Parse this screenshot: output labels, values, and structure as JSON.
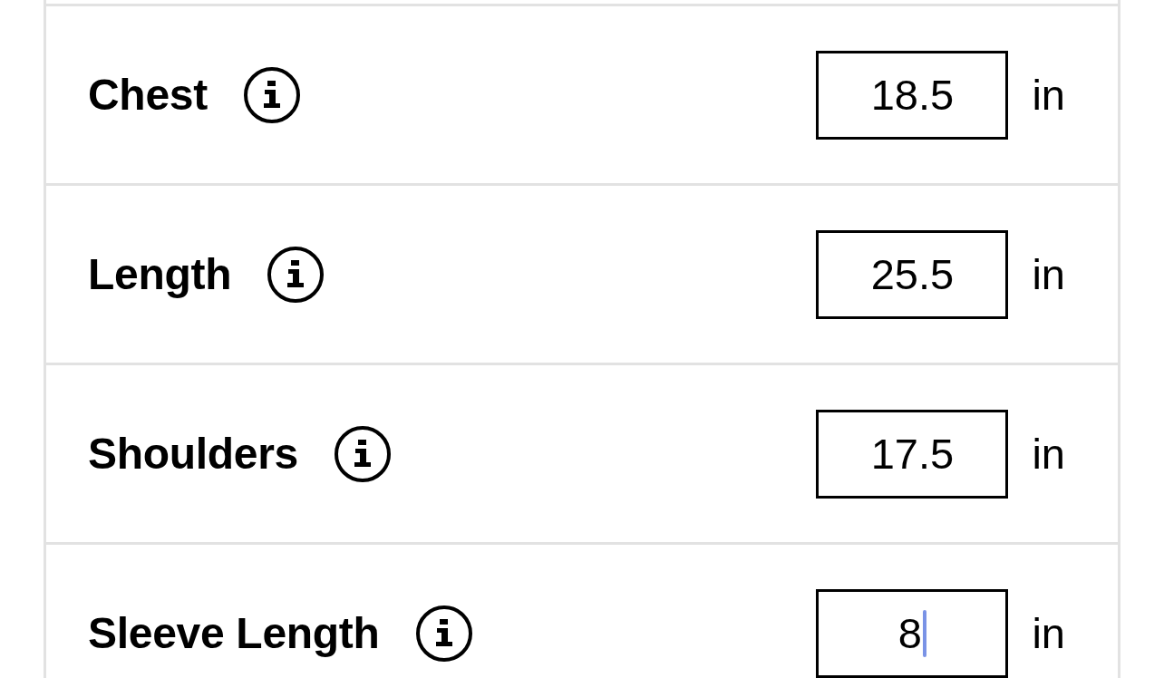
{
  "rows": [
    {
      "label": "Chest",
      "value": "18.5",
      "unit": "in",
      "focused": false
    },
    {
      "label": "Length",
      "value": "25.5",
      "unit": "in",
      "focused": false
    },
    {
      "label": "Shoulders",
      "value": "17.5",
      "unit": "in",
      "focused": false
    },
    {
      "label": "Sleeve Length",
      "value": "8",
      "unit": "in",
      "focused": true
    }
  ]
}
